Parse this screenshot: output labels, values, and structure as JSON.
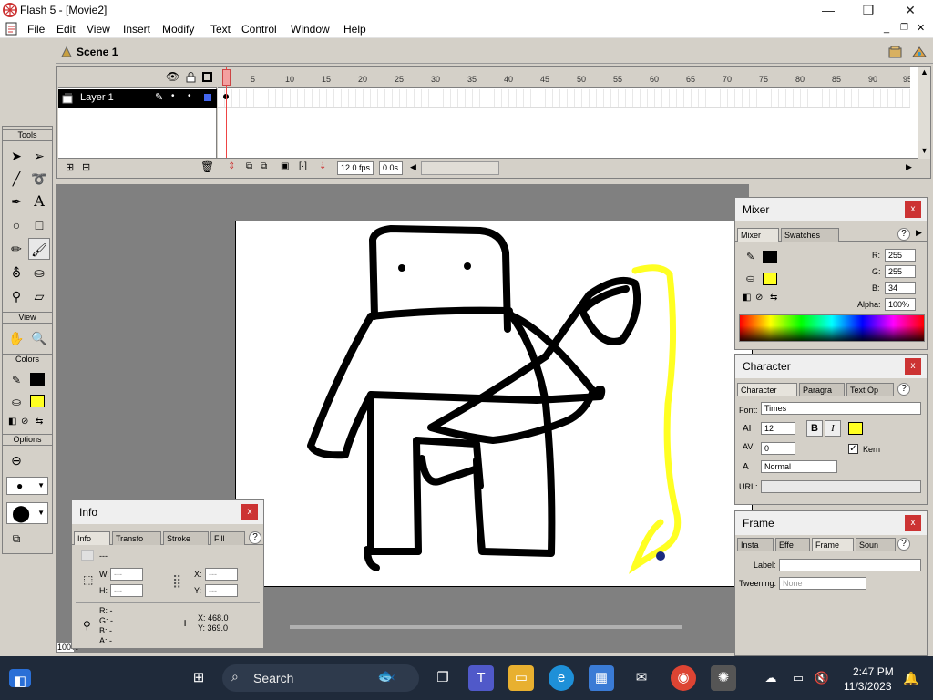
{
  "window": {
    "title": "Flash 5 - [Movie2]",
    "min": "—",
    "max": "❐",
    "close": "✕"
  },
  "menu": [
    "File",
    "Edit",
    "View",
    "Insert",
    "Modify",
    "Text",
    "Control",
    "Window",
    "Help"
  ],
  "scene": {
    "label": "Scene 1"
  },
  "timeline": {
    "layer_name": "Layer 1",
    "ticks": [
      "5",
      "10",
      "15",
      "20",
      "25",
      "30",
      "35",
      "40",
      "45",
      "50",
      "55",
      "60",
      "65",
      "70",
      "75",
      "80",
      "85",
      "90",
      "95"
    ],
    "fps": "12.0 fps",
    "time": "0.0s"
  },
  "tools": {
    "title": "Tools",
    "view_label": "View",
    "colors_label": "Colors",
    "options_label": "Options",
    "stroke_color": "#000000",
    "fill_color": "#FFFF22"
  },
  "zoom": "100%",
  "info_panel": {
    "title": "Info",
    "tabs": [
      "Info",
      "Transfo",
      "Stroke",
      "Fill"
    ],
    "symbol_name": "---",
    "w_label": "W:",
    "w_value": "---",
    "h_label": "H:",
    "h_value": "---",
    "x_label": "X:",
    "x_value": "---",
    "y_label": "Y:",
    "y_value": "---",
    "r_label": "R: -",
    "g_label": "G: -",
    "b_label": "B: -",
    "a_label": "A: -",
    "cursor_x": "X: 468.0",
    "cursor_y": "Y: 369.0"
  },
  "mixer_panel": {
    "title": "Mixer",
    "tabs": [
      "Mixer",
      "Swatches"
    ],
    "r_label": "R:",
    "r_value": "255",
    "g_label": "G:",
    "g_value": "255",
    "b_label": "B:",
    "b_value": "34",
    "alpha_label": "Alpha:",
    "alpha_value": "100%",
    "stroke_color": "#000000",
    "fill_color": "#FFFF22"
  },
  "character_panel": {
    "title": "Character",
    "tabs": [
      "Character",
      "Paragra",
      "Text Op"
    ],
    "font_label": "Font:",
    "font_value": "Times",
    "size_value": "12",
    "bold": "B",
    "italic": "I",
    "tracking_value": "0",
    "kern_label": "Kern",
    "baseline_value": "Normal",
    "url_label": "URL:",
    "text_color": "#FFFF22"
  },
  "frame_panel": {
    "title": "Frame",
    "tabs": [
      "Insta",
      "Effe",
      "Frame",
      "Soun"
    ],
    "label_label": "Label:",
    "tweening_label": "Tweening:",
    "tweening_value": "None"
  },
  "taskbar": {
    "search": "Search",
    "time": "2:47 PM",
    "date": "11/3/2023"
  }
}
